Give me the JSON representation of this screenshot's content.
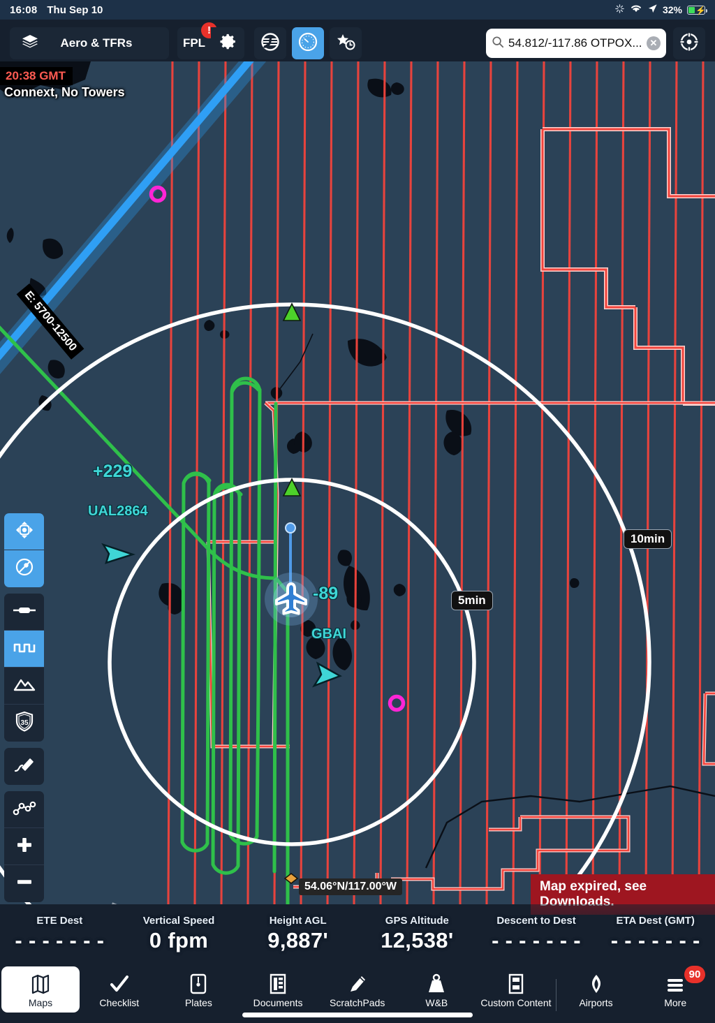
{
  "status_bar": {
    "time": "16:08",
    "date": "Thu Sep 10",
    "battery_percent": "32%",
    "icons": [
      "bluetooth-icon",
      "wifi-icon",
      "location-arrow-icon",
      "battery-charging-icon"
    ]
  },
  "toolbar": {
    "layers_label": "Aero & TFRs",
    "fpl_label": "FPL",
    "fpl_badge": "!",
    "buttons": [
      {
        "name": "layers-icon",
        "label": "Aero & TFRs",
        "active": false
      },
      {
        "name": "fpl-button",
        "label": "FPL",
        "active": false
      },
      {
        "name": "settings-gear-icon",
        "label": "",
        "active": false
      },
      {
        "name": "scratchpad-icon",
        "label": "",
        "active": false
      },
      {
        "name": "instruments-gauge-icon",
        "label": "",
        "active": true
      },
      {
        "name": "favorites-recents-icon",
        "label": "",
        "active": false
      }
    ],
    "search_value": "54.812/-117.86 OTPOX...",
    "search_placeholder": "Search",
    "clear_label": "✕",
    "locate_icon": "crosshair-target-icon"
  },
  "map": {
    "gmt_time": "20:38 GMT",
    "connext_status": "Connext, No Towers",
    "airway_label": "E: 5700-12500",
    "range_ring_5min": "5min",
    "range_ring_10min": "10min",
    "coordinate_label": "54.06°N/117.00°W",
    "expired_banner": "Map expired, see Downloads.",
    "traffic": [
      {
        "callsign": "UAL2864",
        "relative_altitude": "+229"
      },
      {
        "callsign": "GBAI",
        "relative_altitude": "-89"
      }
    ],
    "colors": {
      "background": "#2b4257",
      "tfr_line": "#f2443c",
      "route_green": "#2fc04a",
      "range_ring": "#ffffff",
      "airway_blue": "#2b9bf0",
      "traffic_cyan": "#3fd6d6",
      "waypoint_magenta": "#ff25d6",
      "accent_blue": "#4aa3e8"
    }
  },
  "map_tools": [
    {
      "name": "center-on-aircraft-icon",
      "active": true
    },
    {
      "name": "track-up-mode-icon",
      "active": true
    },
    {
      "name": "flight-level-bar-icon",
      "active": false
    },
    {
      "name": "altitude-profile-icon",
      "active": true
    },
    {
      "name": "terrain-icon",
      "active": false
    },
    {
      "name": "speed-limit-35-shield-icon",
      "active": false
    },
    {
      "name": "draw-pen-icon",
      "active": false
    },
    {
      "name": "route-nodes-icon",
      "active": false
    },
    {
      "name": "zoom-in-icon",
      "active": false
    },
    {
      "name": "zoom-out-icon",
      "active": false
    }
  ],
  "data_bar": [
    {
      "label": "ETE Dest",
      "value": "- - - - - - -"
    },
    {
      "label": "Vertical Speed",
      "value": "0 fpm"
    },
    {
      "label": "Height AGL",
      "value": "9,887'"
    },
    {
      "label": "GPS Altitude",
      "value": "12,538'"
    },
    {
      "label": "Descent to Dest",
      "value": "- - - - - - -"
    },
    {
      "label": "ETA Dest (GMT)",
      "value": "- - - - - - -"
    }
  ],
  "tab_bar": {
    "tabs": [
      {
        "label": "Maps",
        "icon": "map-icon",
        "selected": true,
        "badge": ""
      },
      {
        "label": "Checklist",
        "icon": "checkmark-icon",
        "selected": false,
        "badge": ""
      },
      {
        "label": "Plates",
        "icon": "plate-page-icon",
        "selected": false,
        "badge": ""
      },
      {
        "label": "Documents",
        "icon": "documents-icon",
        "selected": false,
        "badge": ""
      },
      {
        "label": "ScratchPads",
        "icon": "pencil-icon",
        "selected": false,
        "badge": ""
      },
      {
        "label": "W&B",
        "icon": "weight-icon",
        "selected": false,
        "badge": ""
      },
      {
        "label": "Custom Content",
        "icon": "custom-content-icon",
        "selected": false,
        "badge": ""
      },
      {
        "label": "Airports",
        "icon": "airport-diamond-icon",
        "selected": false,
        "badge": ""
      },
      {
        "label": "More",
        "icon": "hamburger-icon",
        "selected": false,
        "badge": "90"
      }
    ]
  }
}
